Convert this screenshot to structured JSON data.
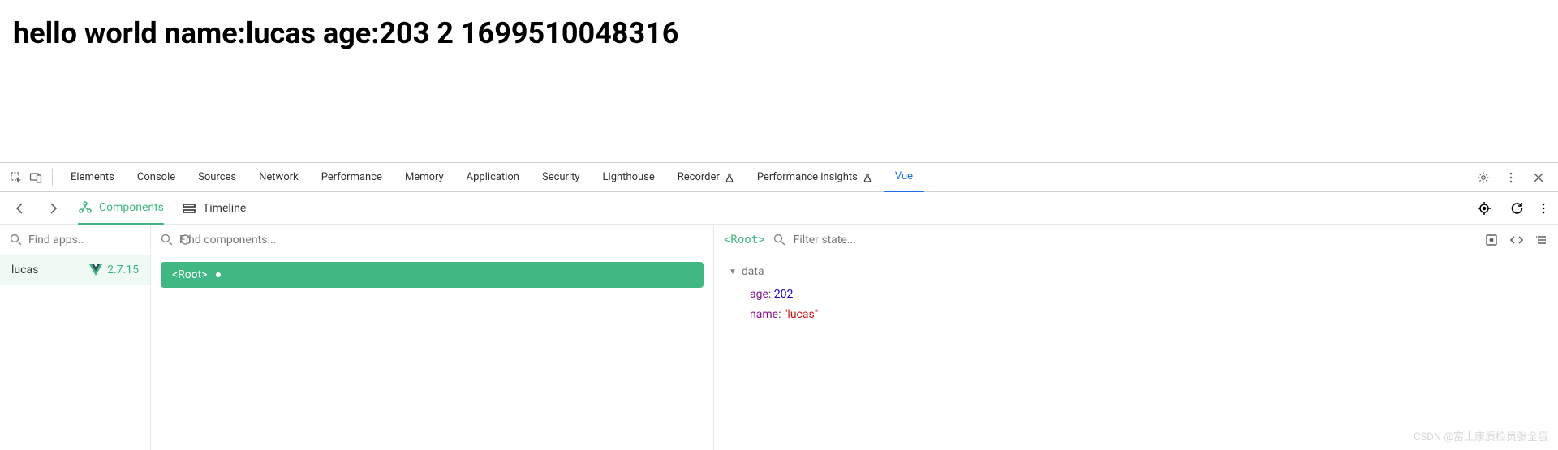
{
  "page": {
    "heading": "hello world name:lucas age:203 2 1699510048316"
  },
  "devtools": {
    "tabs": [
      "Elements",
      "Console",
      "Sources",
      "Network",
      "Performance",
      "Memory",
      "Application",
      "Security",
      "Lighthouse",
      "Recorder",
      "Performance insights",
      "Vue"
    ],
    "activeTab": "Vue"
  },
  "vuePanel": {
    "subTabs": {
      "components": "Components",
      "timeline": "Timeline"
    },
    "apps": {
      "searchPlaceholder": "Find apps..",
      "items": [
        {
          "name": "lucas",
          "version": "2.7.15"
        }
      ]
    },
    "components": {
      "searchPlaceholder": "Find components...",
      "selected": "<Root>"
    },
    "state": {
      "rootLabel": "<Root>",
      "filterPlaceholder": "Filter state...",
      "sectionLabel": "data",
      "data": {
        "age": {
          "key": "age",
          "value": "202"
        },
        "name": {
          "key": "name",
          "value": "\"lucas\""
        }
      }
    }
  },
  "watermark": "CSDN @富士康质检员张全蛋"
}
